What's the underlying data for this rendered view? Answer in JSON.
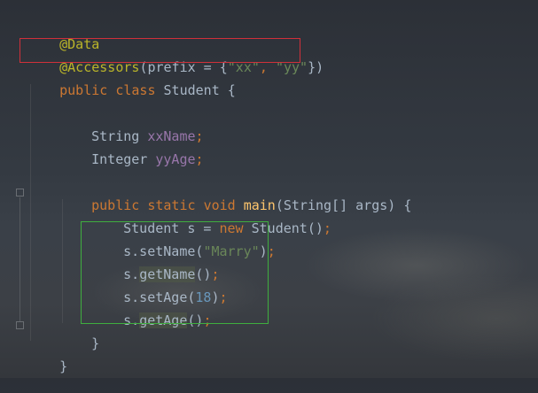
{
  "code": {
    "line1": {
      "annotation": "@Data"
    },
    "line2": {
      "annotation": "@Accessors",
      "open": "(",
      "param": "prefix",
      "eq": " = {",
      "str1": "\"xx\"",
      "comma": ", ",
      "str2": "\"yy\"",
      "close": "})"
    },
    "line3": {
      "kw1": "public",
      "kw2": "class",
      "name": "Student",
      "brace": " {"
    },
    "line4": {
      "type": "String",
      "field": "xxName",
      "semi": ";"
    },
    "line5": {
      "type": "Integer",
      "field": "yyAge",
      "semi": ";"
    },
    "line6": {
      "kw1": "public",
      "kw2": "static",
      "kw3": "void",
      "method": "main",
      "params": "(String[] args) {"
    },
    "line7": {
      "type": "Student",
      "assign": " s = ",
      "kw": "new",
      "ctor": " Student()",
      "semi": ";"
    },
    "line8": {
      "prefix": "s.setName(",
      "str": "\"Marry\"",
      "close": ")",
      "semi": ";"
    },
    "line9": {
      "prefix": "s.",
      "method": "getName",
      "close": "()",
      "semi": ";"
    },
    "line10": {
      "prefix": "s.setAge(",
      "num": "18",
      "close": ")",
      "semi": ";"
    },
    "line11": {
      "prefix": "s.",
      "method": "getAge",
      "close": "()",
      "semi": ";"
    },
    "line12": {
      "brace": "}"
    },
    "line13": {
      "brace": "}"
    }
  }
}
